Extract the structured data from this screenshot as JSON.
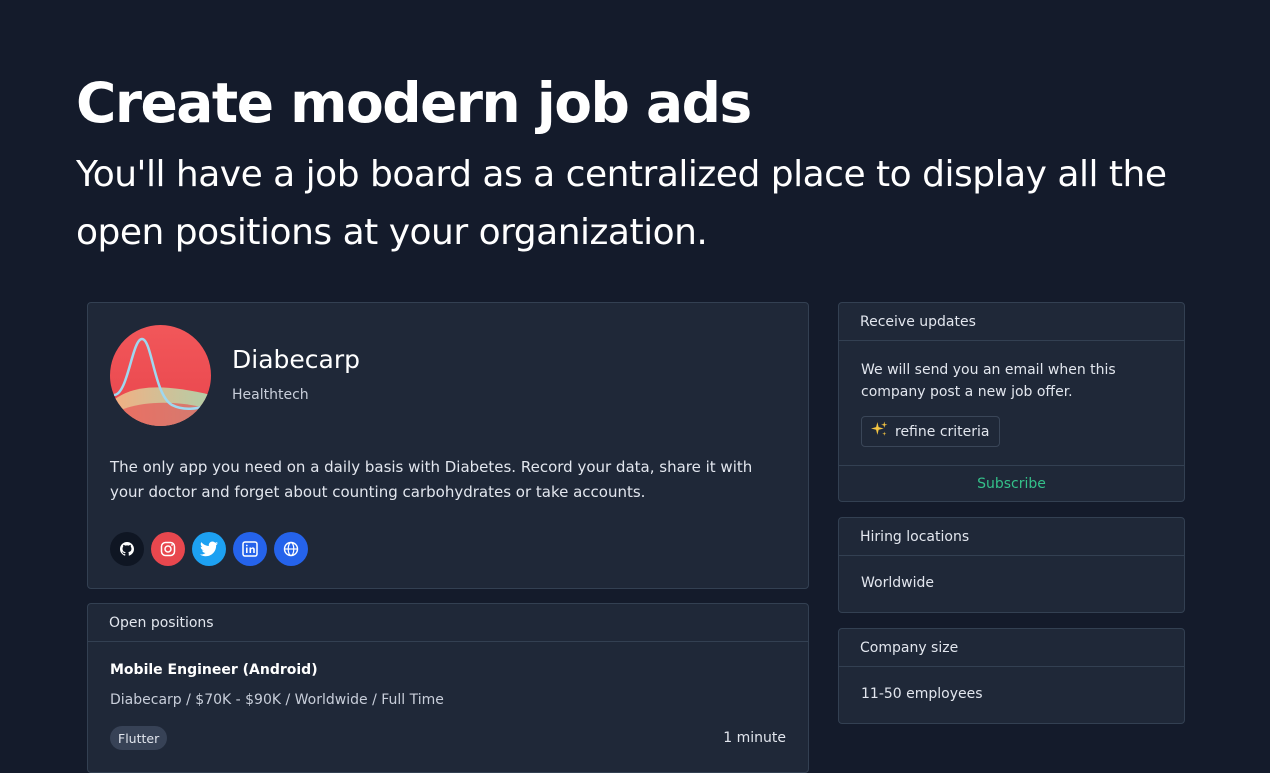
{
  "hero": {
    "title": "Create modern job ads",
    "subtitle": "You'll have a job board as a centralized place to display all the open positions at your organization."
  },
  "company": {
    "name": "Diabecarp",
    "category": "Healthtech",
    "description": "The only app you need on a daily basis with Diabetes. Record your data, share it with your doctor and forget about counting carbohydrates or take accounts.",
    "socials": [
      {
        "name": "github-icon",
        "color": "#0f1623"
      },
      {
        "name": "instagram-icon",
        "color": "#e8474e"
      },
      {
        "name": "twitter-icon",
        "color": "#1da1f2"
      },
      {
        "name": "linkedin-icon",
        "color": "#2563eb"
      },
      {
        "name": "globe-icon",
        "color": "#2563eb"
      }
    ]
  },
  "positions": {
    "header": "Open positions",
    "jobs": [
      {
        "title": "Mobile Engineer (Android)",
        "meta": "Diabecarp / $70K - $90K / Worldwide / Full Time",
        "tag": "Flutter",
        "time": "1 minute"
      }
    ]
  },
  "updates": {
    "header": "Receive updates",
    "text": "We will send you an email when this company post a new job offer.",
    "refine_icon": "sparkles-icon",
    "refine_label": "refine criteria",
    "subscribe_label": "Subscribe",
    "accent": "#34c18a"
  },
  "locations": {
    "header": "Hiring locations",
    "value": "Worldwide"
  },
  "size": {
    "header": "Company size",
    "value": "11-50 employees"
  }
}
